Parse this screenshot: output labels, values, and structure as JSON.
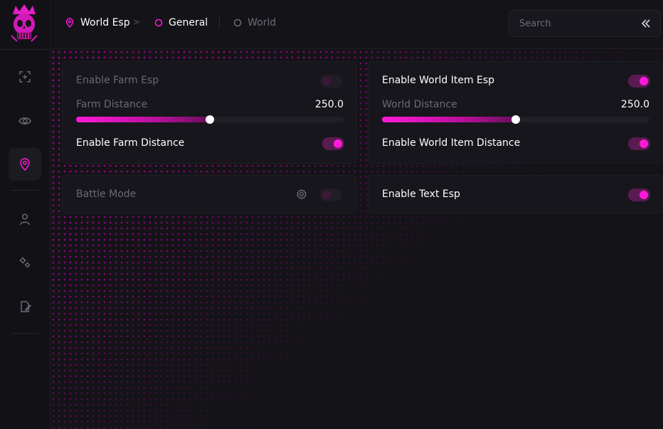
{
  "breadcrumb": {
    "items": [
      {
        "label": "World Esp",
        "icon": "map-pin-icon"
      },
      {
        "label": "General",
        "icon": "circle-icon"
      },
      {
        "label": "World",
        "icon": "circle-icon"
      }
    ]
  },
  "search": {
    "placeholder": "Search"
  },
  "sidebar": {
    "items": [
      {
        "icon": "crosshair-icon"
      },
      {
        "icon": "eye-icon"
      },
      {
        "icon": "map-pin-icon",
        "active": true
      },
      {
        "icon": "user-icon"
      },
      {
        "icon": "gears-icon"
      },
      {
        "icon": "edit-file-icon"
      }
    ]
  },
  "farm_card": {
    "enable_label": "Enable Farm Esp",
    "enable_on": false,
    "distance_label": "Farm Distance",
    "distance_value": "250.0",
    "distance_fraction": 0.5,
    "enable_distance_label": "Enable Farm Distance",
    "enable_distance_on": true
  },
  "battle_card": {
    "label": "Battle Mode",
    "on": false
  },
  "world_card": {
    "enable_label": "Enable World Item Esp",
    "enable_on": true,
    "distance_label": "World Distance",
    "distance_value": "250.0",
    "distance_fraction": 0.5,
    "enable_distance_label": "Enable World Item Distance",
    "enable_distance_on": true
  },
  "text_card": {
    "label": "Enable Text Esp",
    "on": true
  },
  "colors": {
    "accent": "#ff1ad9",
    "background": "#141318",
    "card": "#17161c"
  }
}
